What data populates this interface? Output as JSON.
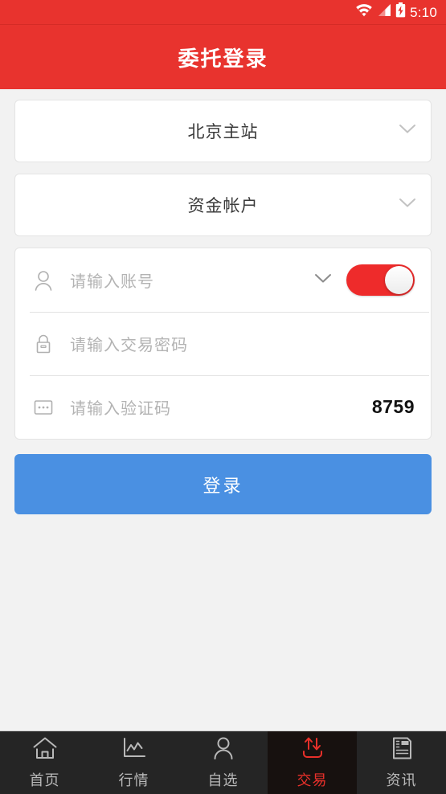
{
  "status_bar": {
    "time": "5:10",
    "icons": [
      "wifi-icon",
      "signal-icon",
      "battery-charging-icon"
    ],
    "background_color": "#e8332e"
  },
  "app_bar": {
    "title": "委托登录",
    "background_color": "#e8332e",
    "text_color": "#ffffff"
  },
  "selects": [
    {
      "name": "site-select",
      "value": "北京主站",
      "icon": "chevron-down-icon"
    },
    {
      "name": "account-type-select",
      "value": "资金帐户",
      "icon": "chevron-down-icon"
    }
  ],
  "form": {
    "account_row": {
      "icon": "person-icon",
      "placeholder": "请输入账号",
      "value": "",
      "dropdown_icon": "chevron-down-icon",
      "toggle": {
        "name": "save-account-toggle",
        "state": "on",
        "color": "#ee2b2b"
      }
    },
    "password_row": {
      "icon": "lock-icon",
      "placeholder": "请输入交易密码",
      "value": ""
    },
    "captcha_row": {
      "icon": "captcha-icon",
      "placeholder": "请输入验证码",
      "value": "",
      "code": "8759"
    }
  },
  "login_button": {
    "label": "登录",
    "color": "#4a90e2",
    "text_color": "#ffffff"
  },
  "bottom_nav": {
    "active_index": 3,
    "active_color": "#e8302a",
    "inactive_color": "#b9b9b9",
    "items": [
      {
        "label": "首页",
        "icon": "home-icon"
      },
      {
        "label": "行情",
        "icon": "chart-icon"
      },
      {
        "label": "自选",
        "icon": "person-icon"
      },
      {
        "label": "交易",
        "icon": "trade-arrows-icon"
      },
      {
        "label": "资讯",
        "icon": "news-icon"
      }
    ]
  }
}
